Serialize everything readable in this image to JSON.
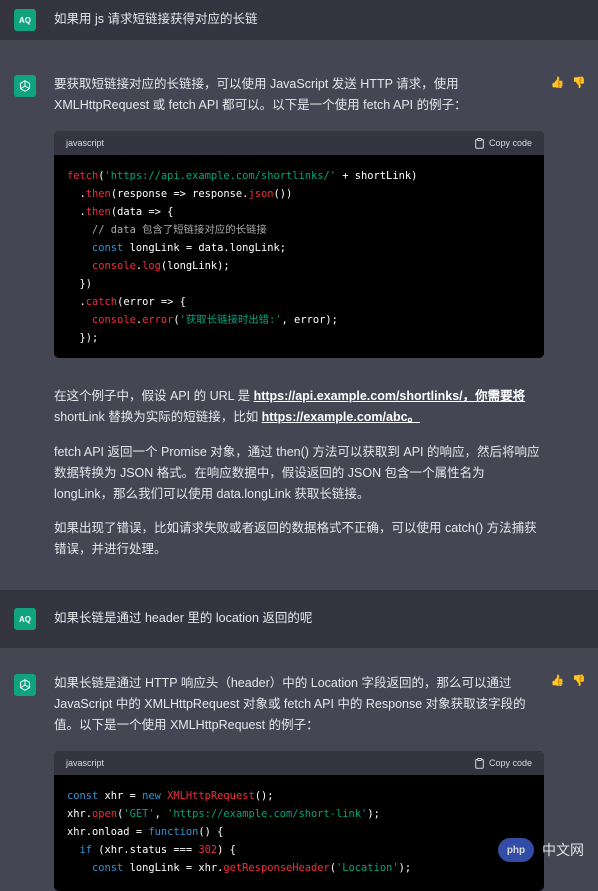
{
  "messages": [
    {
      "role": "user",
      "avatar": "AQ",
      "text": "如果用 js 请求短链接获得对应的长链"
    },
    {
      "role": "assistant",
      "avatar_icon": "openai-logo-icon",
      "intro": "要获取短链接对应的长链接，可以使用 JavaScript 发送 HTTP 请求，使用 XMLHttpRequest 或 fetch API 都可以。以下是一个使用 fetch API 的例子：",
      "code": {
        "language": "javascript",
        "copy_label": "Copy code"
      },
      "para1_a": "在这个例子中，假设 API 的 URL 是 ",
      "para1_link1": "https://api.example.com/shortlinks/，你需要将",
      "para1_b": " shortLink 替换为实际的短链接，比如 ",
      "para1_link2": "https://example.com/abc。",
      "para2": "fetch API 返回一个 Promise 对象，通过 then() 方法可以获取到 API 的响应，然后将响应数据转换为 JSON 格式。在响应数据中，假设返回的 JSON 包含一个属性名为 longLink，那么我们可以使用 data.longLink 获取长链接。",
      "para3": "如果出现了错误，比如请求失败或者返回的数据格式不正确，可以使用 catch() 方法捕获错误，并进行处理。"
    },
    {
      "role": "user",
      "avatar": "AQ",
      "text": "如果长链是通过 header 里的 location 返回的呢"
    },
    {
      "role": "assistant",
      "avatar_icon": "openai-logo-icon",
      "intro": "如果长链是通过 HTTP 响应头（header）中的 Location 字段返回的，那么可以通过 JavaScript 中的 XMLHttpRequest 对象或 fetch API 中的 Response 对象获取该字段的值。以下是一个使用 XMLHttpRequest 的例子：",
      "code": {
        "language": "javascript",
        "copy_label": "Copy code"
      }
    }
  ],
  "watermark": {
    "logo_text": "php",
    "site": "中文网"
  },
  "colors": {
    "user_bg": "#343541",
    "assistant_bg": "#444654",
    "avatar_green": "#10a37f",
    "code_bg": "#000000"
  }
}
